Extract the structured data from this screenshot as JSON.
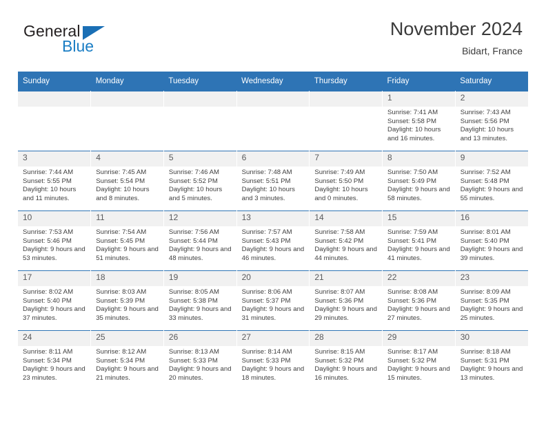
{
  "brand": {
    "name_part1": "General",
    "name_part2": "Blue",
    "triangle_color": "#1a6fb5",
    "blue_color": "#1a7dc4"
  },
  "header": {
    "title": "November 2024",
    "location": "Bidart, France"
  },
  "colors": {
    "header_blue": "#2e74b5",
    "daynum_band": "#f1f1f1",
    "text": "#404040"
  },
  "weekdays": [
    "Sunday",
    "Monday",
    "Tuesday",
    "Wednesday",
    "Thursday",
    "Friday",
    "Saturday"
  ],
  "labels": {
    "sunrise": "Sunrise:",
    "sunset": "Sunset:",
    "daylight": "Daylight:"
  },
  "weeks": [
    [
      {
        "day": "",
        "empty": true
      },
      {
        "day": "",
        "empty": true
      },
      {
        "day": "",
        "empty": true
      },
      {
        "day": "",
        "empty": true
      },
      {
        "day": "",
        "empty": true
      },
      {
        "day": "1",
        "sunrise": "Sunrise: 7:41 AM",
        "sunset": "Sunset: 5:58 PM",
        "daylight": "Daylight: 10 hours and 16 minutes."
      },
      {
        "day": "2",
        "sunrise": "Sunrise: 7:43 AM",
        "sunset": "Sunset: 5:56 PM",
        "daylight": "Daylight: 10 hours and 13 minutes."
      }
    ],
    [
      {
        "day": "3",
        "sunrise": "Sunrise: 7:44 AM",
        "sunset": "Sunset: 5:55 PM",
        "daylight": "Daylight: 10 hours and 11 minutes."
      },
      {
        "day": "4",
        "sunrise": "Sunrise: 7:45 AM",
        "sunset": "Sunset: 5:54 PM",
        "daylight": "Daylight: 10 hours and 8 minutes."
      },
      {
        "day": "5",
        "sunrise": "Sunrise: 7:46 AM",
        "sunset": "Sunset: 5:52 PM",
        "daylight": "Daylight: 10 hours and 5 minutes."
      },
      {
        "day": "6",
        "sunrise": "Sunrise: 7:48 AM",
        "sunset": "Sunset: 5:51 PM",
        "daylight": "Daylight: 10 hours and 3 minutes."
      },
      {
        "day": "7",
        "sunrise": "Sunrise: 7:49 AM",
        "sunset": "Sunset: 5:50 PM",
        "daylight": "Daylight: 10 hours and 0 minutes."
      },
      {
        "day": "8",
        "sunrise": "Sunrise: 7:50 AM",
        "sunset": "Sunset: 5:49 PM",
        "daylight": "Daylight: 9 hours and 58 minutes."
      },
      {
        "day": "9",
        "sunrise": "Sunrise: 7:52 AM",
        "sunset": "Sunset: 5:48 PM",
        "daylight": "Daylight: 9 hours and 55 minutes."
      }
    ],
    [
      {
        "day": "10",
        "sunrise": "Sunrise: 7:53 AM",
        "sunset": "Sunset: 5:46 PM",
        "daylight": "Daylight: 9 hours and 53 minutes."
      },
      {
        "day": "11",
        "sunrise": "Sunrise: 7:54 AM",
        "sunset": "Sunset: 5:45 PM",
        "daylight": "Daylight: 9 hours and 51 minutes."
      },
      {
        "day": "12",
        "sunrise": "Sunrise: 7:56 AM",
        "sunset": "Sunset: 5:44 PM",
        "daylight": "Daylight: 9 hours and 48 minutes."
      },
      {
        "day": "13",
        "sunrise": "Sunrise: 7:57 AM",
        "sunset": "Sunset: 5:43 PM",
        "daylight": "Daylight: 9 hours and 46 minutes."
      },
      {
        "day": "14",
        "sunrise": "Sunrise: 7:58 AM",
        "sunset": "Sunset: 5:42 PM",
        "daylight": "Daylight: 9 hours and 44 minutes."
      },
      {
        "day": "15",
        "sunrise": "Sunrise: 7:59 AM",
        "sunset": "Sunset: 5:41 PM",
        "daylight": "Daylight: 9 hours and 41 minutes."
      },
      {
        "day": "16",
        "sunrise": "Sunrise: 8:01 AM",
        "sunset": "Sunset: 5:40 PM",
        "daylight": "Daylight: 9 hours and 39 minutes."
      }
    ],
    [
      {
        "day": "17",
        "sunrise": "Sunrise: 8:02 AM",
        "sunset": "Sunset: 5:40 PM",
        "daylight": "Daylight: 9 hours and 37 minutes."
      },
      {
        "day": "18",
        "sunrise": "Sunrise: 8:03 AM",
        "sunset": "Sunset: 5:39 PM",
        "daylight": "Daylight: 9 hours and 35 minutes."
      },
      {
        "day": "19",
        "sunrise": "Sunrise: 8:05 AM",
        "sunset": "Sunset: 5:38 PM",
        "daylight": "Daylight: 9 hours and 33 minutes."
      },
      {
        "day": "20",
        "sunrise": "Sunrise: 8:06 AM",
        "sunset": "Sunset: 5:37 PM",
        "daylight": "Daylight: 9 hours and 31 minutes."
      },
      {
        "day": "21",
        "sunrise": "Sunrise: 8:07 AM",
        "sunset": "Sunset: 5:36 PM",
        "daylight": "Daylight: 9 hours and 29 minutes."
      },
      {
        "day": "22",
        "sunrise": "Sunrise: 8:08 AM",
        "sunset": "Sunset: 5:36 PM",
        "daylight": "Daylight: 9 hours and 27 minutes."
      },
      {
        "day": "23",
        "sunrise": "Sunrise: 8:09 AM",
        "sunset": "Sunset: 5:35 PM",
        "daylight": "Daylight: 9 hours and 25 minutes."
      }
    ],
    [
      {
        "day": "24",
        "sunrise": "Sunrise: 8:11 AM",
        "sunset": "Sunset: 5:34 PM",
        "daylight": "Daylight: 9 hours and 23 minutes."
      },
      {
        "day": "25",
        "sunrise": "Sunrise: 8:12 AM",
        "sunset": "Sunset: 5:34 PM",
        "daylight": "Daylight: 9 hours and 21 minutes."
      },
      {
        "day": "26",
        "sunrise": "Sunrise: 8:13 AM",
        "sunset": "Sunset: 5:33 PM",
        "daylight": "Daylight: 9 hours and 20 minutes."
      },
      {
        "day": "27",
        "sunrise": "Sunrise: 8:14 AM",
        "sunset": "Sunset: 5:33 PM",
        "daylight": "Daylight: 9 hours and 18 minutes."
      },
      {
        "day": "28",
        "sunrise": "Sunrise: 8:15 AM",
        "sunset": "Sunset: 5:32 PM",
        "daylight": "Daylight: 9 hours and 16 minutes."
      },
      {
        "day": "29",
        "sunrise": "Sunrise: 8:17 AM",
        "sunset": "Sunset: 5:32 PM",
        "daylight": "Daylight: 9 hours and 15 minutes."
      },
      {
        "day": "30",
        "sunrise": "Sunrise: 8:18 AM",
        "sunset": "Sunset: 5:31 PM",
        "daylight": "Daylight: 9 hours and 13 minutes."
      }
    ]
  ]
}
